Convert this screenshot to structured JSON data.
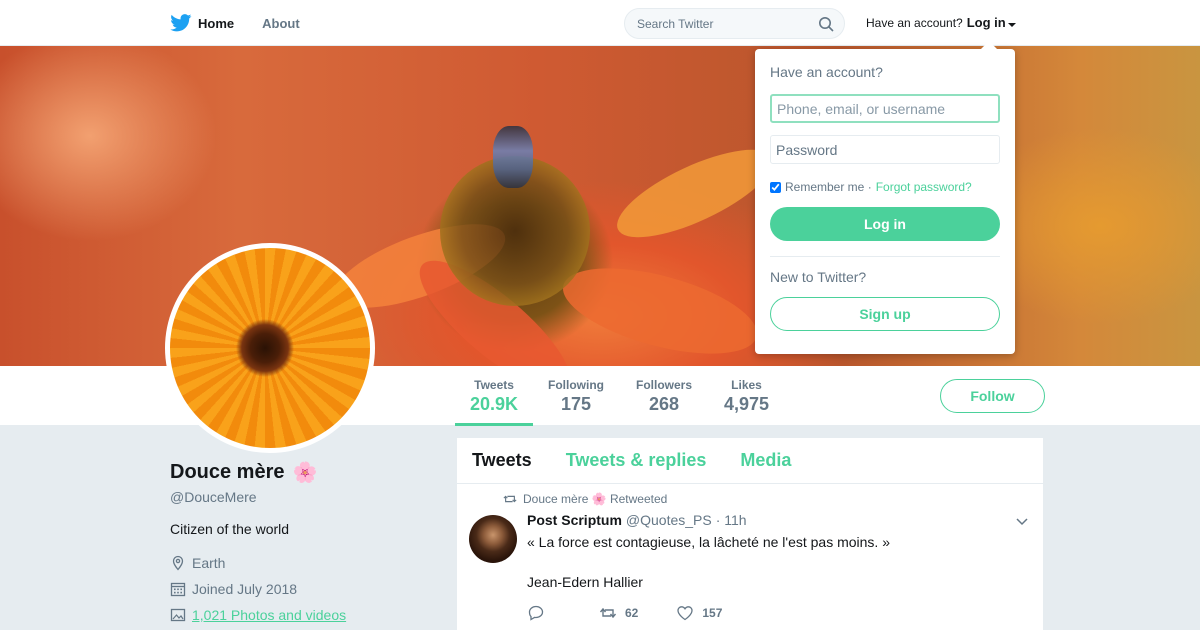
{
  "nav": {
    "home_label": "Home",
    "about_label": "About",
    "search_placeholder": "Search Twitter",
    "account_prompt": "Have an account?",
    "login_label": "Log in",
    "brand_color": "#1da1f2",
    "accent_color": "#4bd19b"
  },
  "stats": [
    {
      "label": "Tweets",
      "value": "20.9K",
      "active": true
    },
    {
      "label": "Following",
      "value": "175"
    },
    {
      "label": "Followers",
      "value": "268"
    },
    {
      "label": "Likes",
      "value": "4,975"
    }
  ],
  "follow_label": "Follow",
  "profile": {
    "name": "Douce mère",
    "name_emoji": "🌸",
    "handle": "@DouceMere",
    "bio": "Citizen of the world",
    "location": "Earth",
    "joined": "Joined July 2018",
    "media_link": "1,021 Photos and videos"
  },
  "tabs": [
    "Tweets",
    "Tweets & replies",
    "Media"
  ],
  "tweet": {
    "retweeted_by": "Douce mère 🌸 Retweeted",
    "author_name": "Post Scriptum",
    "author_handle": "@Quotes_PS",
    "time": "· 11h",
    "text_line1": "« La force est contagieuse, la lâcheté ne l'est pas moins. »",
    "text_line2": "Jean-Edern Hallier",
    "retweets": "62",
    "likes": "157"
  },
  "login_dropdown": {
    "title": "Have an account?",
    "username_placeholder": "Phone, email, or username",
    "password_placeholder": "Password",
    "remember_label": "Remember me ·",
    "forgot_label": "Forgot password?",
    "login_button": "Log in",
    "new_prompt": "New to Twitter?",
    "signup_button": "Sign up"
  }
}
